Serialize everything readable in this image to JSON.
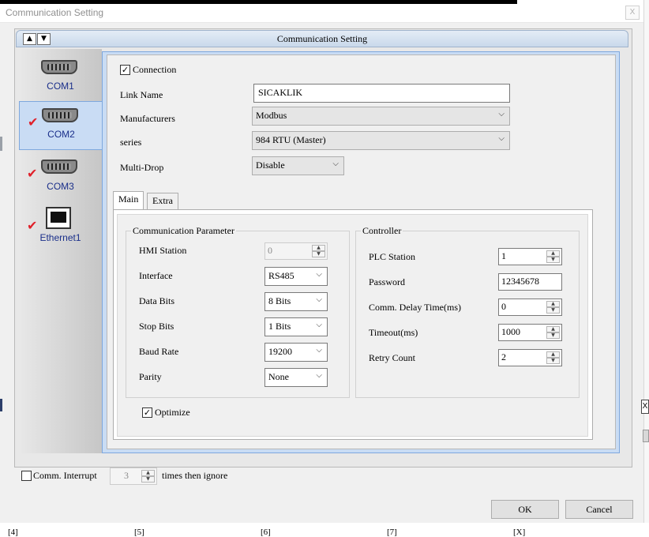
{
  "window": {
    "title": "Communication Setting",
    "close_glyph": "X"
  },
  "panel": {
    "title": "Communication Setting",
    "up_glyph": "▲",
    "down_glyph": "▼"
  },
  "ports": [
    {
      "label": "COM1",
      "icon": "serial-port-icon",
      "checked": false
    },
    {
      "label": "COM2",
      "icon": "serial-port-icon",
      "checked": true,
      "selected": true
    },
    {
      "label": "COM3",
      "icon": "serial-port-icon",
      "checked": true
    },
    {
      "label": "Ethernet1",
      "icon": "ethernet-port-icon",
      "checked": true
    }
  ],
  "check_glyph": "✔",
  "box_check": "✓",
  "connection": {
    "label": "Connection",
    "checked": true
  },
  "link_name": {
    "label": "Link Name",
    "value": "SICAKLIK"
  },
  "manufacturers": {
    "label": "Manufacturers",
    "value": "Modbus"
  },
  "series": {
    "label": "series",
    "value": "984 RTU (Master)"
  },
  "multidrop": {
    "label": "Multi-Drop",
    "value": "Disable"
  },
  "tabs": {
    "main": "Main",
    "extra": "Extra"
  },
  "comm_param": {
    "title": "Communication Parameter",
    "hmi_station": {
      "label": "HMI Station",
      "value": "0"
    },
    "interface": {
      "label": "Interface",
      "value": "RS485"
    },
    "data_bits": {
      "label": "Data Bits",
      "value": "8 Bits"
    },
    "stop_bits": {
      "label": "Stop Bits",
      "value": "1 Bits"
    },
    "baud_rate": {
      "label": "Baud Rate",
      "value": "19200"
    },
    "parity": {
      "label": "Parity",
      "value": "None"
    }
  },
  "controller": {
    "title": "Controller",
    "plc_station": {
      "label": "PLC Station",
      "value": "1"
    },
    "password": {
      "label": "Password",
      "value": "12345678"
    },
    "comm_delay": {
      "label": "Comm. Delay Time(ms)",
      "value": "0"
    },
    "timeout": {
      "label": "Timeout(ms)",
      "value": "1000"
    },
    "retry": {
      "label": "Retry Count",
      "value": "2"
    }
  },
  "optimize": {
    "label": "Optimize",
    "checked": true
  },
  "comm_interrupt": {
    "label": "Comm. Interrupt",
    "checked": false,
    "value": "3",
    "suffix": "times then ignore"
  },
  "buttons": {
    "ok": "OK",
    "cancel": "Cancel"
  },
  "chevron": "⌵",
  "background_tabs": [
    "[4]",
    "[5]",
    "[6]",
    "[7]",
    "[X]"
  ],
  "edge_glyph": "X"
}
